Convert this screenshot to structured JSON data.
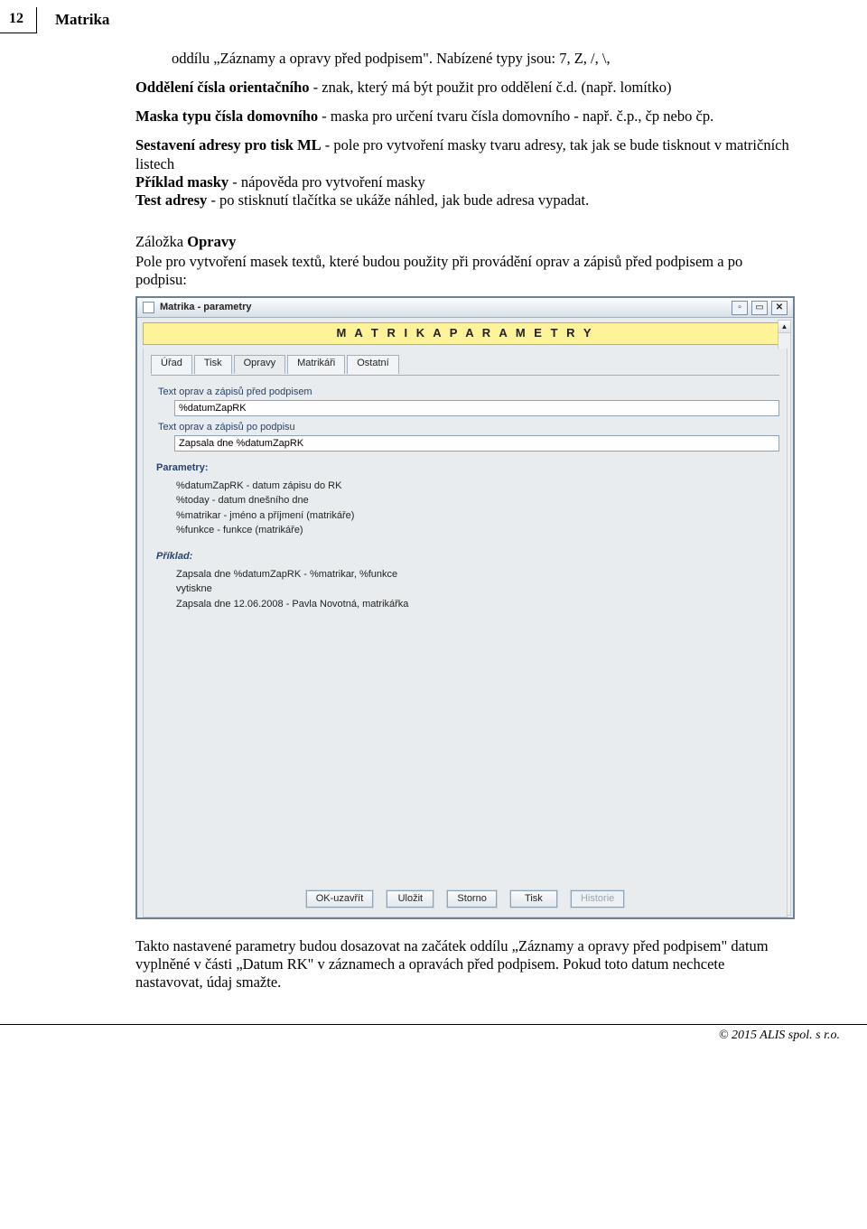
{
  "header": {
    "page_number": "12",
    "title": "Matrika"
  },
  "doc": {
    "p1": "oddílu „Záznamy a opravy před podpisem\". Nabízené typy jsou: 7, Z, /, \\,",
    "p2a": "Oddělení čísla orientačního",
    "p2b": " - znak, který má být použit pro oddělení č.d. (např. lomítko)",
    "p3a": "Maska typu čísla domovního",
    "p3b": " - maska pro určení tvaru čísla domovního - např. č.p., čp nebo čp.",
    "p4a": "Sestavení adresy pro tisk ML",
    "p4b": " - pole pro vytvoření masky tvaru adresy, tak jak se bude tisknout v matričních listech",
    "p5a": "Příklad masky",
    "p5b": " - nápověda pro vytvoření masky",
    "p6a": "Test adresy",
    "p6b": " - po stisknutí tlačítka se ukáže náhled, jak bude adresa vypadat.",
    "p7_prefix": "Záložka ",
    "p7_bold": "Opravy",
    "p7_cont": "Pole pro vytvoření masek textů, které budou použity při provádění oprav a zápisů před podpisem a po podpisu:",
    "p8": "Takto nastavené parametry budou dosazovat na začátek oddílu „Záznamy a opravy před podpisem\" datum vyplněné v části „Datum RK\" v záznamech a opravách před podpisem. Pokud toto datum nechcete nastavovat, údaj smažte."
  },
  "window": {
    "title": "Matrika - parametry",
    "banner": "M A T R I K A   P A R A M E T R Y",
    "tabs": [
      "Úřad",
      "Tisk",
      "Opravy",
      "Matrikáři",
      "Ostatní"
    ],
    "active_tab_index": 2,
    "field1_label": "Text oprav a zápisů před podpisem",
    "field1_value": "%datumZapRK",
    "field2_label": "Text oprav a zápisů po podpisu",
    "field2_value": "Zapsala dne %datumZapRK",
    "params_header": "Parametry:",
    "params": [
      "%datumZapRK - datum zápisu do RK",
      "%today - datum dnešního dne",
      "%matrikar - jméno a příjmení (matrikáře)",
      "%funkce - funkce (matrikáře)"
    ],
    "example_header": "Příklad:",
    "example_lines": [
      "Zapsala dne %datumZapRK - %matrikar, %funkce",
      "vytiskne",
      "Zapsala dne 12.06.2008 - Pavla Novotná, matrikářka"
    ],
    "buttons": {
      "ok": "OK-uzavřít",
      "save": "Uložit",
      "cancel": "Storno",
      "print": "Tisk",
      "history": "Historie"
    },
    "winctrl": {
      "min": "▫",
      "max": "▭",
      "close": "✕"
    }
  },
  "footer": "© 2015 ALIS spol. s r.o."
}
